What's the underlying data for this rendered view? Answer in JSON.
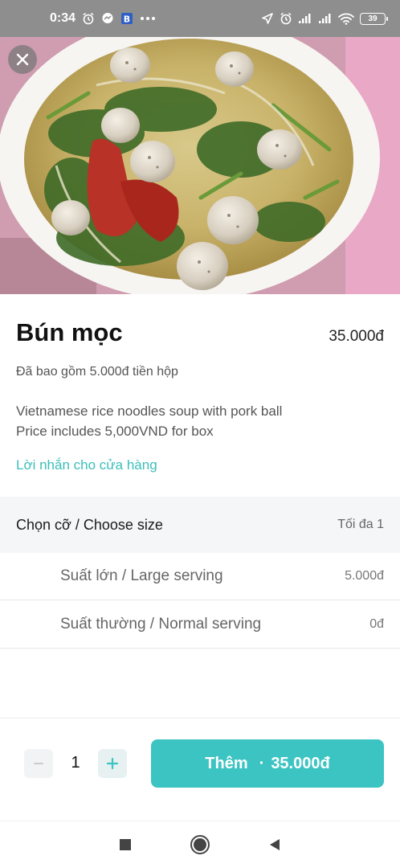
{
  "status_bar": {
    "time": "0:34",
    "battery": "39"
  },
  "product": {
    "name": "Bún mọc",
    "price": "35.000đ",
    "box_note": "Đã bao gồm 5.000đ tiền hộp",
    "description_line1": "Vietnamese rice noodles soup with pork ball",
    "description_line2": "Price includes 5,000VND for box",
    "note_link": "Lời nhắn cho cửa hàng"
  },
  "options": {
    "title": "Chọn cỡ / Choose size",
    "max_label": "Tối đa 1",
    "items": [
      {
        "label": "Suất lớn / Large serving",
        "price": "5.000đ"
      },
      {
        "label": "Suất thường / Normal serving",
        "price": "0đ"
      }
    ]
  },
  "cart": {
    "quantity": "1",
    "add_label": "Thêm",
    "add_separator": "·",
    "add_total": "35.000đ"
  },
  "colors": {
    "accent": "#3bc4c2",
    "link": "#3bbfba",
    "status_bar_bg": "#8e8e8e"
  },
  "icons": {
    "close": "close-icon",
    "minus": "minus-icon",
    "plus": "plus-icon",
    "nav_recents": "square-icon",
    "nav_home": "circle-icon",
    "nav_back": "triangle-back-icon"
  }
}
